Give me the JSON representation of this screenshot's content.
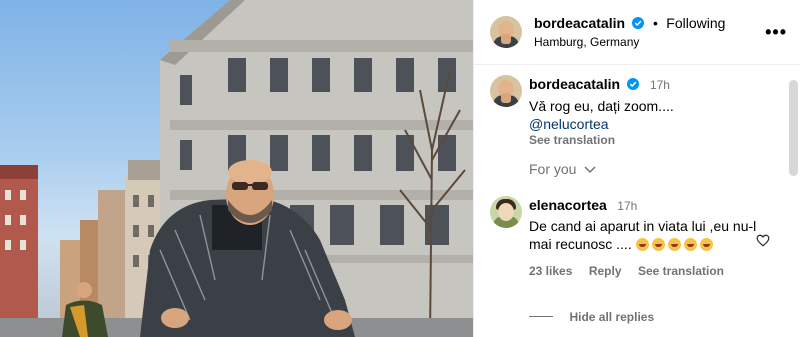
{
  "post": {
    "author": "bordeacatalin",
    "follow_status": "Following",
    "location": "Hamburg, Germany",
    "more_label": "•••"
  },
  "caption": {
    "author": "bordeacatalin",
    "time": "17h",
    "text": "Vă rog eu, dați zoom....",
    "mention": "@nelucortea",
    "see_translation": "See translation"
  },
  "for_you": {
    "label": "For you"
  },
  "comment": {
    "author": "elenacortea",
    "time": "17h",
    "text": "De cand ai aparut in viata lui ,eu nu-l mai recunosc ....",
    "emoji_count": 5,
    "likes": "23 likes",
    "reply": "Reply",
    "see_translation": "See translation",
    "hide_replies": "Hide all replies"
  },
  "colors": {
    "verified": "#0095f6",
    "link": "#00376b",
    "muted": "#737373"
  },
  "icons": [
    "verified-badge-icon",
    "more-options-icon",
    "chevron-down-icon",
    "heart-icon"
  ]
}
